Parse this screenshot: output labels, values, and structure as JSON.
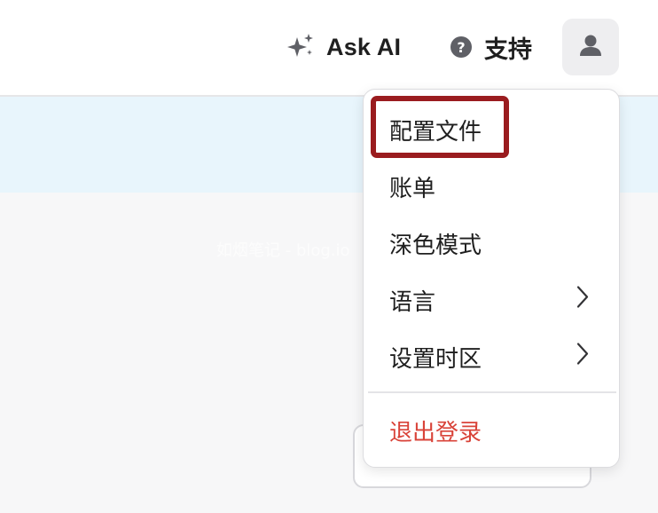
{
  "header": {
    "ask_ai_label": "Ask AI",
    "support_label": "支持",
    "support_icon_glyph": "?",
    "icons": {
      "ask_ai": "sparkle-icon",
      "support": "help-circle-icon",
      "avatar": "user-avatar-icon"
    }
  },
  "watermark": "如烟笔记 - blog.io",
  "user_menu": {
    "items": [
      {
        "label": "配置文件",
        "has_submenu": false,
        "highlighted": true
      },
      {
        "label": "账单",
        "has_submenu": false
      },
      {
        "label": "深色模式",
        "has_submenu": false
      },
      {
        "label": "语言",
        "has_submenu": true
      },
      {
        "label": "设置时区",
        "has_submenu": true
      }
    ],
    "logout_label": "退出登录"
  },
  "colors": {
    "logout_text": "#d94339",
    "highlight_border": "#9a1c1f",
    "banner_background": "#e8f5fc"
  }
}
